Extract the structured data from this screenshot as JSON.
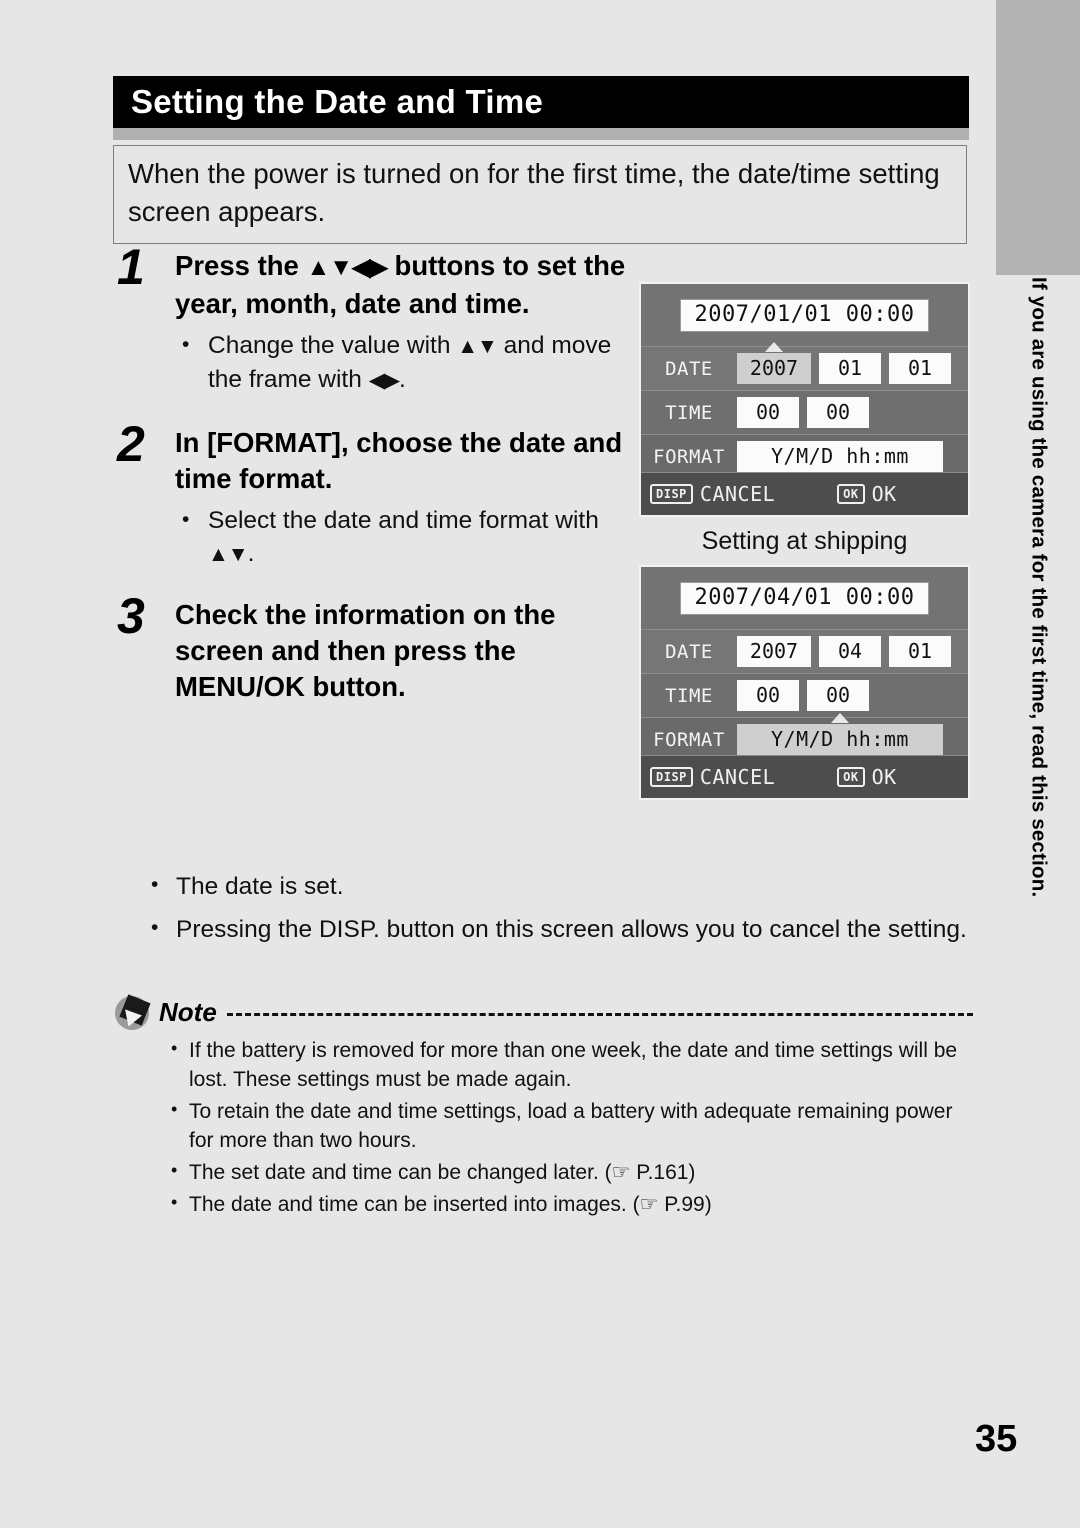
{
  "page": {
    "number": "35",
    "side_tab_text": "If you are using the camera for the first time, read this section."
  },
  "header": {
    "title": "Setting the Date and Time"
  },
  "intro": {
    "text": "When the power is turned on for the first time, the date/time setting screen appears."
  },
  "steps": [
    {
      "number": "1",
      "heading_pre": "Press the ",
      "heading_symbols": "▲▼◀▶",
      "heading_post": " buttons to set the year, month, date and time.",
      "bullets": [
        {
          "pre": "Change the value with ",
          "symbols": "▲▼",
          "mid": " and move the frame with ",
          "symbols2": "◀▶",
          "post": "."
        }
      ]
    },
    {
      "number": "2",
      "heading_pre": "In [FORMAT], choose the date and time format.",
      "heading_symbols": "",
      "heading_post": "",
      "bullets": [
        {
          "pre": "Select the date and time format with ",
          "symbols": "▲▼",
          "mid": "",
          "symbols2": "",
          "post": "."
        }
      ]
    },
    {
      "number": "3",
      "heading_pre": "Check the information on the screen and then press the MENU/OK button.",
      "heading_symbols": "",
      "heading_post": "",
      "bullets": []
    }
  ],
  "step3_bullets": [
    "The date is set.",
    "Pressing the DISP. button on this screen allows you to cancel the setting."
  ],
  "note": {
    "label": "Note",
    "items": [
      "If the battery is removed for more than one week, the date and time settings will be lost. These settings must be made again.",
      "To retain the date and time settings, load a battery with adequate remaining power for more than two hours.",
      "The set date and time can be changed later. (☞ P.161)",
      "The date and time can be inserted into images. (☞ P.99)"
    ]
  },
  "lcd_screens": [
    {
      "readout": "2007/01/01 00:00",
      "date_label": "DATE",
      "date_year": "2007",
      "date_month": "01",
      "date_day": "01",
      "time_label": "TIME",
      "time_hour": "00",
      "time_min": "00",
      "format_label": "FORMAT",
      "format_value": "Y/M/D hh:mm",
      "selected": "date_year",
      "disp_badge": "DISP",
      "cancel_label": "CANCEL",
      "ok_badge": "OK",
      "ok_label": "OK"
    },
    {
      "readout": "2007/04/01 00:00",
      "date_label": "DATE",
      "date_year": "2007",
      "date_month": "04",
      "date_day": "01",
      "time_label": "TIME",
      "time_hour": "00",
      "time_min": "00",
      "format_label": "FORMAT",
      "format_value": "Y/M/D hh:mm",
      "selected": "format_value",
      "disp_badge": "DISP",
      "cancel_label": "CANCEL",
      "ok_badge": "OK",
      "ok_label": "OK"
    }
  ],
  "lcd_caption": "Setting at shipping"
}
